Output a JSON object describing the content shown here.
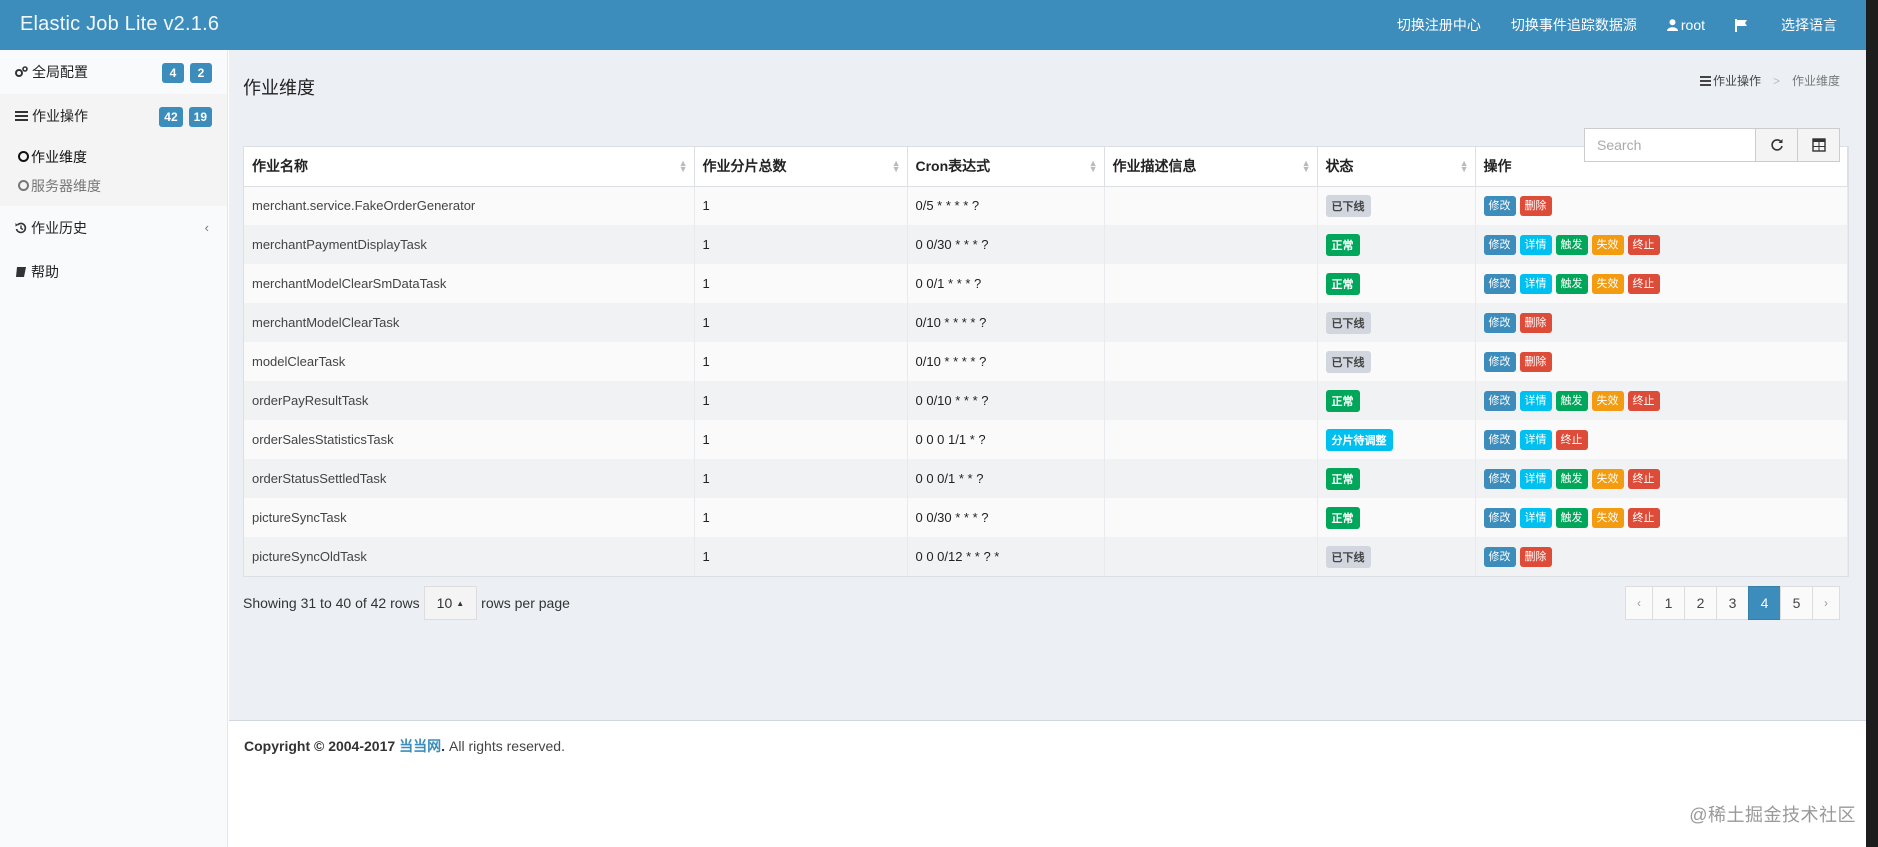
{
  "app": {
    "title": "Elastic Job Lite v2.1.6"
  },
  "topnav": {
    "registry": "切换注册中心",
    "datasource": "切换事件追踪数据源",
    "user": "root",
    "language": "选择语言"
  },
  "sidebar": {
    "global": {
      "label": "全局配置",
      "badge1": "4",
      "badge2": "2"
    },
    "ops": {
      "label": "作业操作",
      "badge1": "42",
      "badge2": "19"
    },
    "sub_job": "作业维度",
    "sub_server": "服务器维度",
    "history": "作业历史",
    "help": "帮助"
  },
  "page": {
    "title": "作业维度",
    "breadcrumb_1": "作业操作",
    "breadcrumb_sep": ">",
    "breadcrumb_2": "作业维度"
  },
  "search": {
    "placeholder": "Search"
  },
  "table": {
    "headers": [
      "作业名称",
      "作业分片总数",
      "Cron表达式",
      "作业描述信息",
      "状态",
      "操作"
    ],
    "rows": [
      {
        "name": "merchant.service.FakeOrderGenerator",
        "shards": "1",
        "cron": "0/5 * * * * ?",
        "desc": "",
        "status": "已下线",
        "status_type": "offline",
        "ops": [
          "修改",
          "删除"
        ]
      },
      {
        "name": "merchantPaymentDisplayTask",
        "shards": "1",
        "cron": "0 0/30 * * * ?",
        "desc": "",
        "status": "正常",
        "status_type": "ok",
        "ops": [
          "修改",
          "详情",
          "触发",
          "失效",
          "终止"
        ]
      },
      {
        "name": "merchantModelClearSmDataTask",
        "shards": "1",
        "cron": "0 0/1 * * * ?",
        "desc": "",
        "status": "正常",
        "status_type": "ok",
        "ops": [
          "修改",
          "详情",
          "触发",
          "失效",
          "终止"
        ]
      },
      {
        "name": "merchantModelClearTask",
        "shards": "1",
        "cron": "0/10 * * * * ?",
        "desc": "",
        "status": "已下线",
        "status_type": "offline",
        "ops": [
          "修改",
          "删除"
        ]
      },
      {
        "name": "modelClearTask",
        "shards": "1",
        "cron": "0/10 * * * * ?",
        "desc": "",
        "status": "已下线",
        "status_type": "offline",
        "ops": [
          "修改",
          "删除"
        ]
      },
      {
        "name": "orderPayResultTask",
        "shards": "1",
        "cron": "0 0/10 * * * ?",
        "desc": "",
        "status": "正常",
        "status_type": "ok",
        "ops": [
          "修改",
          "详情",
          "触发",
          "失效",
          "终止"
        ]
      },
      {
        "name": "orderSalesStatisticsTask",
        "shards": "1",
        "cron": "0 0 0 1/1 * ?",
        "desc": "",
        "status": "分片待调整",
        "status_type": "adjust",
        "ops": [
          "修改",
          "详情",
          "终止"
        ]
      },
      {
        "name": "orderStatusSettledTask",
        "shards": "1",
        "cron": "0 0 0/1 * * ?",
        "desc": "",
        "status": "正常",
        "status_type": "ok",
        "ops": [
          "修改",
          "详情",
          "触发",
          "失效",
          "终止"
        ]
      },
      {
        "name": "pictureSyncTask",
        "shards": "1",
        "cron": "0 0/30 * * * ?",
        "desc": "",
        "status": "正常",
        "status_type": "ok",
        "ops": [
          "修改",
          "详情",
          "触发",
          "失效",
          "终止"
        ]
      },
      {
        "name": "pictureSyncOldTask",
        "shards": "1",
        "cron": "0 0 0/12 * * ? *",
        "desc": "",
        "status": "已下线",
        "status_type": "offline",
        "ops": [
          "修改",
          "删除"
        ]
      }
    ]
  },
  "pagination": {
    "showing": "Showing 31 to 40 of 42 rows",
    "per_page_value": "10",
    "per_page_suffix": "rows per page",
    "prev": "‹",
    "next": "›",
    "pages": [
      "1",
      "2",
      "3",
      "4",
      "5"
    ],
    "active_page": "4"
  },
  "footer": {
    "copyright": "Copyright © 2004-2017",
    "link": "当当网",
    "rights": ". All rights reserved."
  },
  "watermark": "@稀土掘金技术社区",
  "colors": {
    "primary": "#3c8dbc",
    "success": "#00a65a",
    "info": "#00c0ef",
    "warning": "#f39c12",
    "danger": "#dd4b39"
  }
}
